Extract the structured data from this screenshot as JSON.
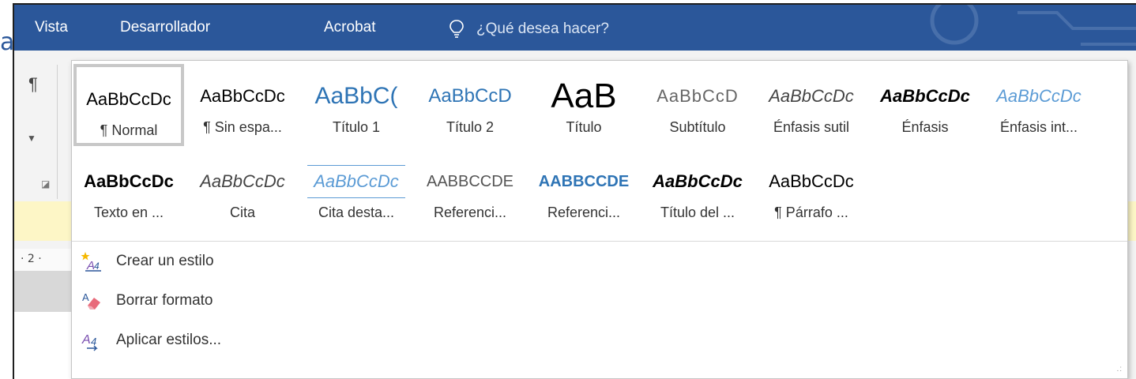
{
  "tabs": [
    "Vista",
    "Desarrollador",
    "Acrobat"
  ],
  "tell_me": {
    "icon": "lightbulb-icon",
    "placeholder": "¿Qué desea hacer?"
  },
  "edge_letter": "a",
  "ribbon": {
    "paragraph_mark": "¶",
    "ruler_number": "· 2 ·"
  },
  "gallery": {
    "row1": [
      {
        "preview": "AaBbCcDc",
        "label": "¶ Normal",
        "selected": true
      },
      {
        "preview": "AaBbCcDc",
        "label": "¶ Sin espa..."
      },
      {
        "preview": "AaBbC(",
        "label": "Título 1"
      },
      {
        "preview": "AaBbCcD",
        "label": "Título 2"
      },
      {
        "preview": "AaB",
        "label": "Título"
      },
      {
        "preview": "AaBbCcD",
        "label": "Subtítulo"
      },
      {
        "preview": "AaBbCcDc",
        "label": "Énfasis sutil"
      },
      {
        "preview": "AaBbCcDc",
        "label": "Énfasis"
      },
      {
        "preview": "AaBbCcDc",
        "label": "Énfasis int..."
      }
    ],
    "row2": [
      {
        "preview": "AaBbCcDc",
        "label": "Texto en ..."
      },
      {
        "preview": "AaBbCcDc",
        "label": "Cita"
      },
      {
        "preview": "AaBbCcDc",
        "label": "Cita desta..."
      },
      {
        "preview": "AABBCCDE",
        "label": "Referenci..."
      },
      {
        "preview": "AABBCCDE",
        "label": "Referenci..."
      },
      {
        "preview": "AaBbCcDc",
        "label": "Título del ..."
      },
      {
        "preview": "AaBbCcDc",
        "label": "¶ Párrafo ..."
      }
    ],
    "commands": [
      {
        "label": "Crear un estilo",
        "icon": "create-style-icon"
      },
      {
        "label": "Borrar formato",
        "icon": "eraser-icon"
      },
      {
        "label": "Aplicar estilos...",
        "icon": "apply-styles-icon"
      }
    ]
  },
  "colors": {
    "ribbon_blue": "#2b579a",
    "heading_blue": "#2e74b5",
    "emphasis_blue": "#5b9bd5",
    "selection_gray": "#c8c8c8"
  }
}
